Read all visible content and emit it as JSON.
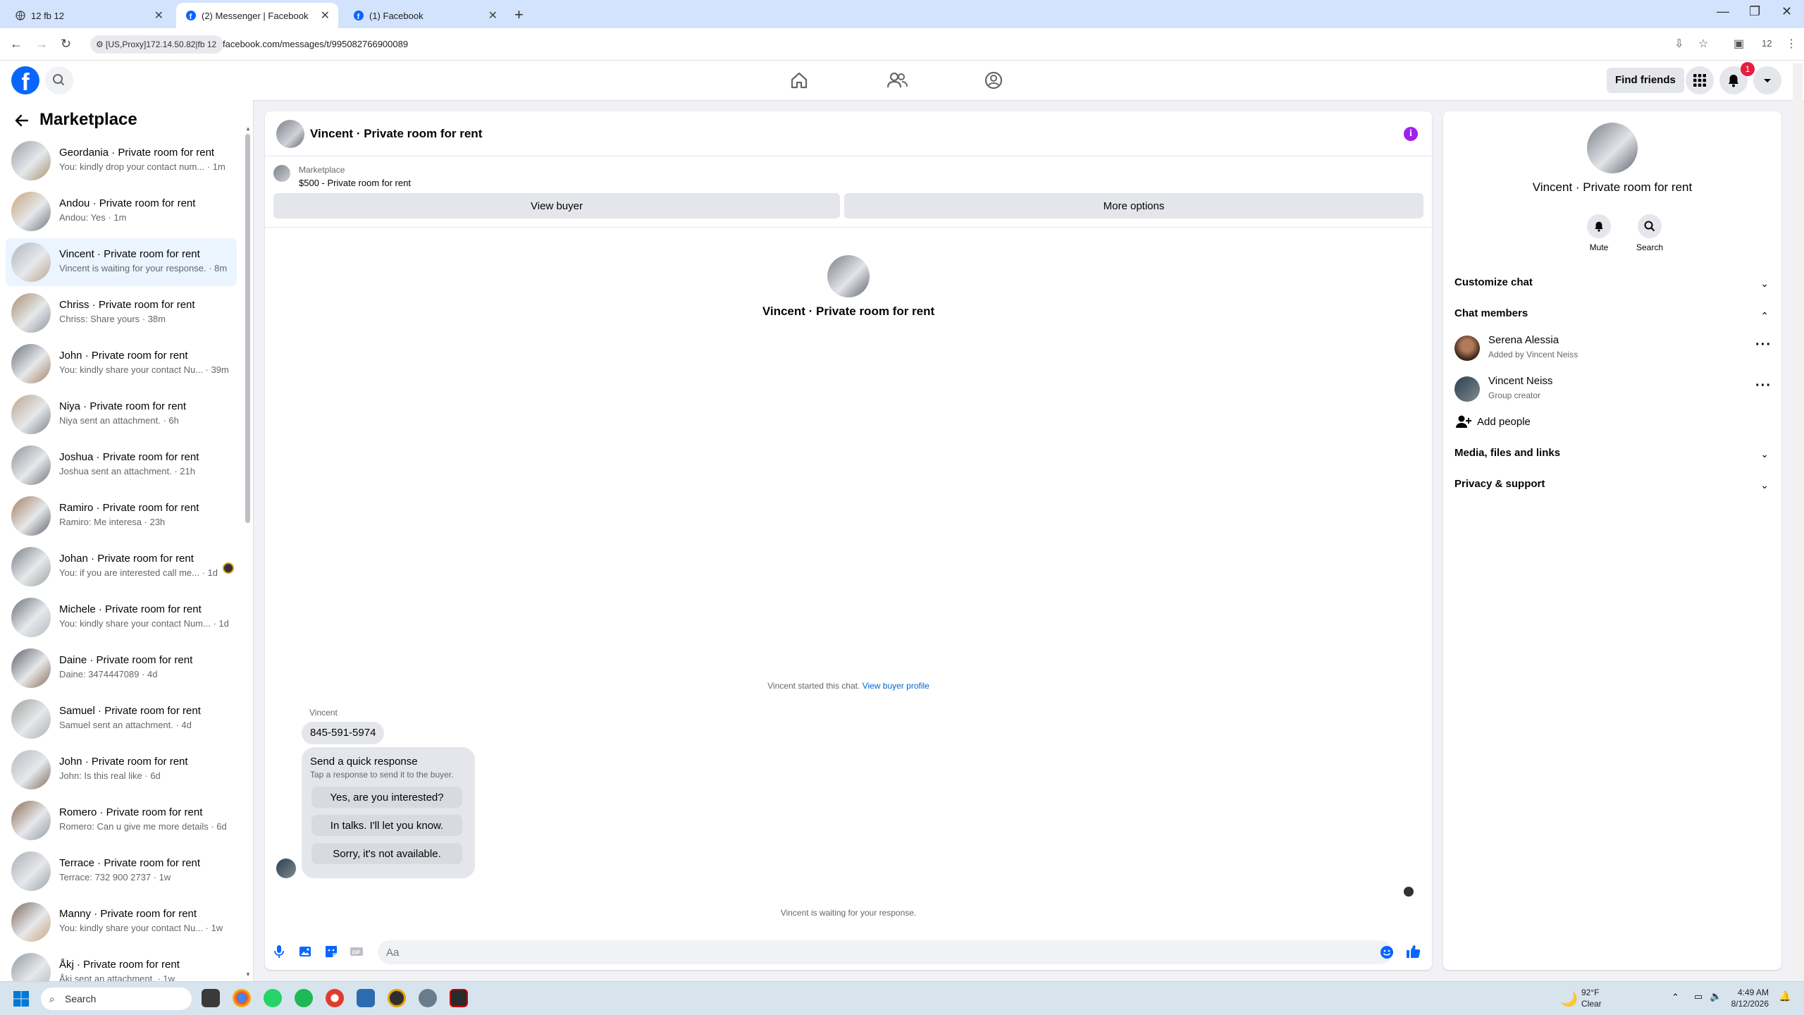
{
  "browser": {
    "tabs": [
      {
        "label": "12 fb 12"
      },
      {
        "label": "(2) Messenger | Facebook"
      },
      {
        "label": "(1) Facebook"
      }
    ],
    "proxy_label": "[US,Proxy]172.14.50.82|fb 12",
    "url": "facebook.com/messages/t/995082766900089",
    "profile_badge": "12"
  },
  "header": {
    "logo": "f",
    "find_friends": "Find friends",
    "notif_count": "1"
  },
  "sidebar": {
    "title": "Marketplace",
    "conversations": [
      {
        "name": "Geordania · Private room for rent",
        "preview": "You: kindly drop your contact num... · 1m"
      },
      {
        "name": "Andou · Private room for rent",
        "preview": "Andou: Yes · 1m"
      },
      {
        "name": "Vincent · Private room for rent",
        "preview": "Vincent is waiting for your response. · 8m"
      },
      {
        "name": "Chriss · Private room for rent",
        "preview": "Chriss: Share yours · 38m"
      },
      {
        "name": "John · Private room for rent",
        "preview": "You: kindly share your contact Nu... · 39m"
      },
      {
        "name": "Niya · Private room for rent",
        "preview": "Niya sent an attachment. · 6h"
      },
      {
        "name": "Joshua · Private room for rent",
        "preview": "Joshua sent an attachment. · 21h"
      },
      {
        "name": "Ramiro · Private room for rent",
        "preview": "Ramiro: Me interesa · 23h"
      },
      {
        "name": "Johan · Private room for rent",
        "preview": "You: if you are interested call me... · 1d"
      },
      {
        "name": "Michele · Private room for rent",
        "preview": "You: kindly share your contact Num... · 1d"
      },
      {
        "name": "Daine · Private room for rent",
        "preview": "Daine: 3474447089 · 4d"
      },
      {
        "name": "Samuel · Private room for rent",
        "preview": "Samuel sent an attachment. · 4d"
      },
      {
        "name": "John · Private room for rent",
        "preview": "John: Is this real like · 6d"
      },
      {
        "name": "Romero · Private room for rent",
        "preview": "Romero: Can u give me more details · 6d"
      },
      {
        "name": "Terrace · Private room for rent",
        "preview": "Terrace: 732 900 2737 · 1w"
      },
      {
        "name": "Manny · Private room for rent",
        "preview": "You: kindly share your contact Nu... · 1w"
      },
      {
        "name": "Åkj · Private room for rent",
        "preview": "Åkj sent an attachment. · 1w"
      }
    ]
  },
  "chat": {
    "title": "Vincent · Private room for rent",
    "listing_source": "Marketplace",
    "listing_price": "$500 - Private room for rent",
    "view_buyer": "View buyer",
    "more_options": "More options",
    "intro_name": "Vincent · Private room for rent",
    "started_text": "Vincent started this chat.",
    "started_link": "View buyer profile",
    "sender": "Vincent",
    "phone_msg": "845-591-5974",
    "quick_title": "Send a quick response",
    "quick_sub": "Tap a response to send it to the buyer.",
    "quick_1": "Yes, are you interested?",
    "quick_2": "In talks. I'll let you know.",
    "quick_3": "Sorry, it's not available.",
    "waiting": "Vincent is waiting for your response.",
    "input_placeholder": "Aa"
  },
  "rpanel": {
    "name": "Vincent · Private room for rent",
    "mute": "Mute",
    "search": "Search",
    "customize": "Customize chat",
    "members_title": "Chat members",
    "member1_name": "Serena Alessia",
    "member1_sub": "Added by Vincent Neiss",
    "member2_name": "Vincent Neiss",
    "member2_sub": "Group creator",
    "add_people": "Add people",
    "media": "Media, files and links",
    "privacy": "Privacy & support"
  },
  "taskbar": {
    "search": "Search",
    "weather_temp": "92°F",
    "weather_cond": "Clear",
    "time": "4:49 AM",
    "date": "8/12/2026"
  },
  "colors": {
    "fb_blue": "#0866ff",
    "selected_bg": "#ebf5ff",
    "badge_red": "#e41e3f",
    "info_purple": "#a020f0"
  }
}
